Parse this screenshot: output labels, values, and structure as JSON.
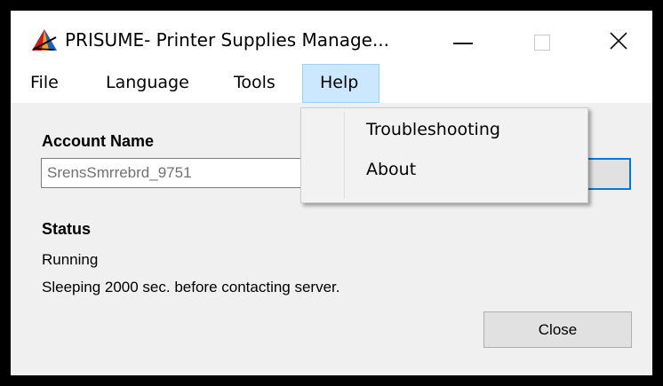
{
  "window": {
    "title": "PRISUME- Printer Supplies Manage...",
    "icon": "prisume-app-icon"
  },
  "title_controls": {
    "minimize_icon": "minimize-icon",
    "maximize_icon": "maximize-icon",
    "close_icon": "close-icon"
  },
  "menubar": {
    "file": "File",
    "language": "Language",
    "tools": "Tools",
    "help": "Help"
  },
  "help_menu": {
    "items": [
      "Troubleshooting",
      "About"
    ]
  },
  "account": {
    "label": "Account Name",
    "value": "SrensSmrrebrd_9751"
  },
  "status": {
    "label": "Status",
    "state": "Running",
    "message": "Sleeping 2000 sec. before contacting server."
  },
  "buttons": {
    "close": "Close"
  },
  "colors": {
    "menu_highlight": "#cce8ff",
    "focus_border": "#0078d7",
    "window_bg": "#f0f0f0"
  }
}
